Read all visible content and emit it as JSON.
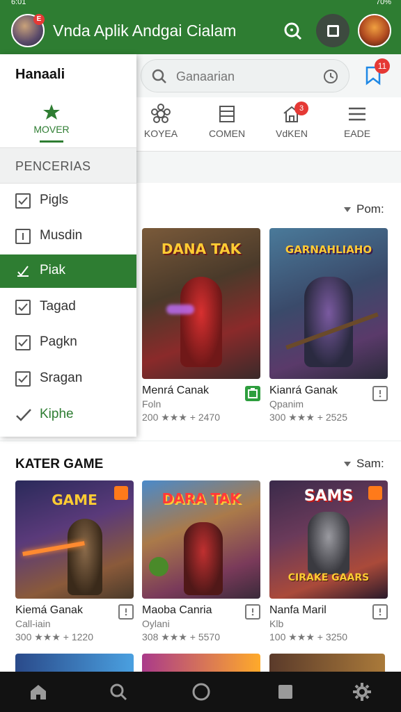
{
  "status": {
    "left": "6:01",
    "right": "70%"
  },
  "appbar": {
    "title": "Vnda Aplik Andgai Cialam",
    "avatar_badge": "E"
  },
  "search": {
    "placeholder": "Ganaarian"
  },
  "bookmark_count": "11",
  "tabs": [
    {
      "label": "KOYEA",
      "icon": "gear-flower-icon"
    },
    {
      "label": "COMEN",
      "icon": "list-box-icon"
    },
    {
      "label": "VdKEN",
      "icon": "home-icon",
      "badge": "3"
    },
    {
      "label": "EADE",
      "icon": "menu-icon"
    }
  ],
  "drawer": {
    "title": "Hanaali",
    "tab_label": "MOVER",
    "category_header": "PENCERIAS",
    "items": [
      {
        "label": "Pigls",
        "state": "checked"
      },
      {
        "label": "Musdin",
        "state": "info"
      },
      {
        "label": "Piak",
        "state": "active"
      },
      {
        "label": "Tagad",
        "state": "checked"
      },
      {
        "label": "Pagkn",
        "state": "checked"
      },
      {
        "label": "Sragan",
        "state": "checked"
      },
      {
        "label": "Kiphe",
        "state": "check"
      }
    ]
  },
  "section1": {
    "sort_label": "Pom:",
    "cards": [
      {
        "art_title": "DANA TAK",
        "name": "Menrá Canak",
        "sub": "Foln",
        "meta": "200 ★★★ + 2470"
      },
      {
        "art_title": "GARNAHLIAHO",
        "name": "Kianrá Ganak",
        "sub": "Qpanim",
        "meta": "300 ★★★ + 2525"
      }
    ]
  },
  "section2": {
    "title": "KATER GAME",
    "sort_label": "Sam:",
    "cards": [
      {
        "art_title": "GAME",
        "name": "Kiemá Ganak",
        "sub": "Call-iain",
        "meta": "300 ★★★ + 1220"
      },
      {
        "art_title": "DARA TAK",
        "name": "Maoba Canria",
        "sub": "Oylani",
        "meta": "308 ★★★ + 5570"
      },
      {
        "art_title": "SAMS",
        "art_sub": "CIRAKE GAARS",
        "name": "Nanfa Maril",
        "sub": "Klb",
        "meta": "100 ★★★ + 3250"
      }
    ]
  },
  "colors": {
    "primary": "#2e7d32",
    "badge": "#e53935",
    "accent": "#ff7a1a"
  }
}
